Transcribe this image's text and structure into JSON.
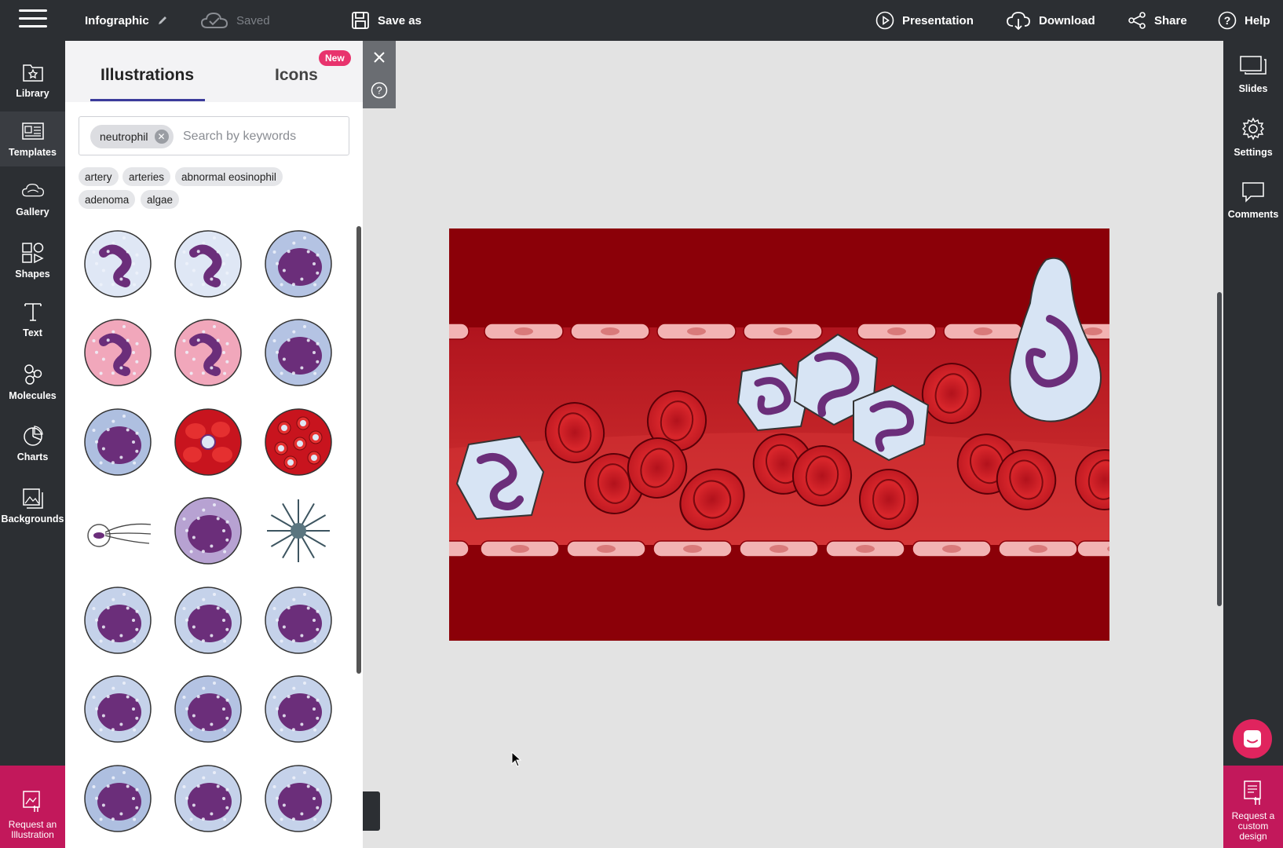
{
  "topbar": {
    "menu_icon": "hamburger-icon",
    "doc_title": "Infographic",
    "save_status": "Saved",
    "save_as": "Save as",
    "presentation": "Presentation",
    "download": "Download",
    "share": "Share",
    "help": "Help"
  },
  "leftbar": {
    "items": [
      {
        "label": "Library",
        "icon": "library-icon"
      },
      {
        "label": "Templates",
        "icon": "templates-icon"
      },
      {
        "label": "Gallery",
        "icon": "gallery-icon"
      },
      {
        "label": "Shapes",
        "icon": "shapes-icon"
      },
      {
        "label": "Text",
        "icon": "text-icon"
      },
      {
        "label": "Molecules",
        "icon": "molecules-icon"
      },
      {
        "label": "Charts",
        "icon": "charts-icon"
      },
      {
        "label": "Backgrounds",
        "icon": "backgrounds-icon"
      }
    ],
    "request": "Request an Illustration"
  },
  "panel": {
    "tabs": [
      "Illustrations",
      "Icons"
    ],
    "new_badge": "New",
    "search_chip": "neutrophil",
    "search_placeholder": "Search by keywords",
    "suggestions": [
      "artery",
      "arteries",
      "abnormal eosinophil",
      "adenoma",
      "algae"
    ],
    "illustrations": [
      "neutrophil",
      "neutrophil",
      "basophil",
      "eosinophil",
      "eosinophil",
      "basophil",
      "monocyte",
      "red-blood-cells",
      "red-blood-cells-infected",
      "sperm-cell",
      "granular-cell",
      "spiky-cell",
      "granulocyte",
      "granulocyte",
      "granulocyte",
      "granulocyte",
      "lymphocyte",
      "granulocyte",
      "monocyte",
      "granulocyte",
      "granulocyte"
    ]
  },
  "rightbar": {
    "slides": "Slides",
    "settings": "Settings",
    "comments": "Comments",
    "request": "Request a custom design"
  },
  "colors": {
    "dark": "#2c2f33",
    "accent": "#c2185b",
    "badge": "#e8336d",
    "vessel": "#8b0008"
  }
}
